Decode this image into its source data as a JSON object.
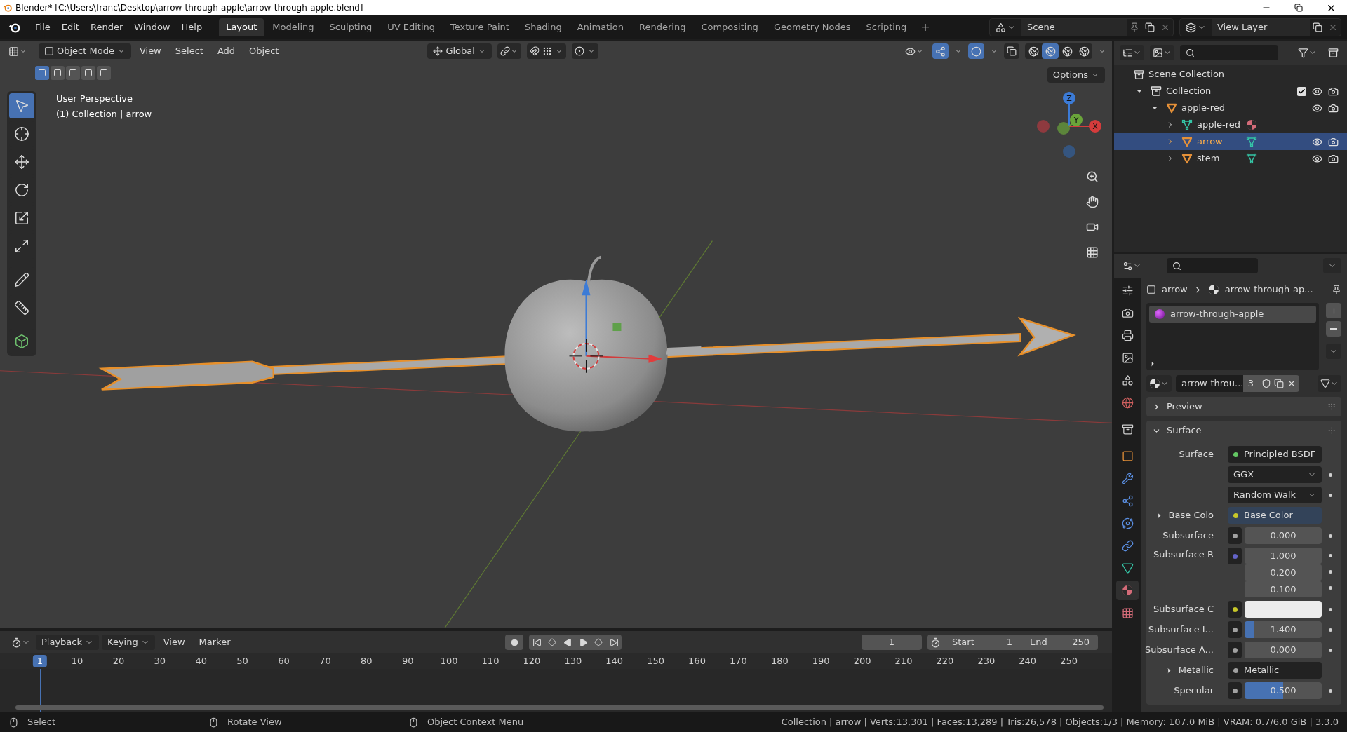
{
  "window": {
    "title": "Blender* [C:\\Users\\franc\\Desktop\\arrow-through-apple\\arrow-through-apple.blend]"
  },
  "menu": [
    "File",
    "Edit",
    "Render",
    "Window",
    "Help"
  ],
  "workspaces": [
    {
      "label": "Layout",
      "selected": true
    },
    {
      "label": "Modeling",
      "selected": false
    },
    {
      "label": "Sculpting",
      "selected": false
    },
    {
      "label": "UV Editing",
      "selected": false
    },
    {
      "label": "Texture Paint",
      "selected": false
    },
    {
      "label": "Shading",
      "selected": false
    },
    {
      "label": "Animation",
      "selected": false
    },
    {
      "label": "Rendering",
      "selected": false
    },
    {
      "label": "Compositing",
      "selected": false
    },
    {
      "label": "Geometry Nodes",
      "selected": false
    },
    {
      "label": "Scripting",
      "selected": false
    }
  ],
  "add_workspace": "+",
  "scene": "Scene",
  "view_layer": "View Layer",
  "viewport": {
    "mode": "Object Mode",
    "menus": [
      "View",
      "Select",
      "Add",
      "Object"
    ],
    "orientation": "Global",
    "options": "Options",
    "info": [
      "User Perspective",
      "(1) Collection | arrow"
    ],
    "axes": [
      "Z",
      "Y",
      "X"
    ],
    "gizmos_on": true,
    "overlays_on": true,
    "select_modes": [
      {
        "selected": true
      },
      {
        "selected": false
      },
      {
        "selected": false
      },
      {
        "selected": false
      },
      {
        "selected": false
      }
    ],
    "tools": [
      {
        "kind": "select",
        "selected": true
      },
      {
        "kind": "cursor",
        "selected": false
      },
      {
        "kind": "move",
        "selected": false
      },
      {
        "kind": "rotate",
        "selected": false
      },
      {
        "kind": "scale",
        "selected": false
      },
      {
        "kind": "transform",
        "selected": false
      },
      {
        "kind": "annotate",
        "selected": false
      },
      {
        "kind": "measure",
        "selected": false
      },
      {
        "kind": "add",
        "selected": false
      }
    ],
    "shading": [
      {
        "selected": false
      },
      {
        "selected": true
      },
      {
        "selected": false
      },
      {
        "selected": false
      }
    ]
  },
  "outliner": {
    "root": "Scene Collection",
    "items": [
      {
        "label": "Collection",
        "kind": "collection",
        "expanded": true,
        "checked": true,
        "selected": false,
        "children": [
          {
            "label": "apple-red",
            "kind": "object",
            "expanded": true,
            "selected": false,
            "children": [
              {
                "label": "apple-red",
                "kind": "mesh",
                "expanded": false,
                "selected": false,
                "badge": {
                  "kind": "material"
                }
              },
              {
                "label": "arrow",
                "kind": "object",
                "expanded": false,
                "selected": true,
                "badge": {
                  "kind": "mesh"
                }
              },
              {
                "label": "stem",
                "kind": "object",
                "expanded": false,
                "selected": false,
                "badge": {
                  "kind": "mesh"
                }
              }
            ]
          }
        ]
      }
    ]
  },
  "properties": {
    "tabs": [
      {
        "kind": "tool",
        "selected": false
      },
      {
        "kind": "render",
        "selected": false
      },
      {
        "kind": "output",
        "selected": false
      },
      {
        "kind": "view_layer",
        "selected": false
      },
      {
        "kind": "scene",
        "selected": false
      },
      {
        "kind": "world",
        "selected": false
      },
      {
        "kind": "collection",
        "selected": false
      },
      {
        "kind": "object",
        "selected": false
      },
      {
        "kind": "modifier",
        "selected": false
      },
      {
        "kind": "particles",
        "selected": false
      },
      {
        "kind": "physics",
        "selected": false
      },
      {
        "kind": "constraints",
        "selected": false
      },
      {
        "kind": "data",
        "selected": false
      },
      {
        "kind": "material",
        "selected": true
      },
      {
        "kind": "texture",
        "selected": false
      }
    ],
    "breadcrumb": [
      "arrow",
      "arrow-through-ap..."
    ],
    "slots": [
      {
        "label": "arrow-through-apple",
        "selected": true
      }
    ],
    "material": "arrow-throu...",
    "users": "3",
    "panels": [
      {
        "label": "Preview",
        "expanded": false
      },
      {
        "label": "Surface",
        "expanded": true
      }
    ],
    "rows": [
      {
        "kind": "link",
        "label": "Surface",
        "value": "Principled BSDF",
        "color": "#63c763",
        "expandable": false,
        "highlighted": false
      },
      {
        "kind": "dropdown",
        "value": "GGX"
      },
      {
        "kind": "dropdown",
        "value": "Random Walk"
      },
      {
        "kind": "link",
        "label": "Base Colo",
        "value": "Base Color",
        "color": "#c7c729",
        "expandable": true,
        "highlighted": true
      },
      {
        "kind": "slider",
        "label": "Subsurface",
        "value": "0.000",
        "color": "#a1a1a1"
      },
      {
        "kind": "vector",
        "label": "Subsurface R",
        "values": [
          "1.000",
          "0.200",
          "0.100"
        ],
        "color": "#6363c7"
      },
      {
        "kind": "swatch",
        "label": "Subsurface C",
        "swatch": {
          "color": "#ececec"
        },
        "color": "#c7c729"
      },
      {
        "kind": "slider",
        "label": "Subsurface I...",
        "value": "1.400",
        "level": 0.12,
        "color": "#a1a1a1"
      },
      {
        "kind": "slider",
        "label": "Subsurface A...",
        "value": "0.000",
        "color": "#a1a1a1"
      },
      {
        "kind": "link",
        "label": "Metallic",
        "value": "Metallic",
        "color": "#a1a1a1",
        "expandable": true,
        "highlighted": false
      },
      {
        "kind": "slider",
        "label": "Specular",
        "value": "0.500",
        "level": 0.5,
        "color": "#a1a1a1"
      }
    ]
  },
  "timeline": {
    "menus": [
      "Playback",
      "Keying",
      "View",
      "Marker"
    ],
    "frame": "1",
    "start_label": "Start",
    "start": "1",
    "end_label": "End",
    "end": "250",
    "ticks": [
      {
        "label": "1",
        "selected": true
      },
      {
        "label": "10",
        "selected": false
      },
      {
        "label": "20",
        "selected": false
      },
      {
        "label": "30",
        "selected": false
      },
      {
        "label": "40",
        "selected": false
      },
      {
        "label": "50",
        "selected": false
      },
      {
        "label": "60",
        "selected": false
      },
      {
        "label": "70",
        "selected": false
      },
      {
        "label": "80",
        "selected": false
      },
      {
        "label": "90",
        "selected": false
      },
      {
        "label": "100",
        "selected": false
      },
      {
        "label": "110",
        "selected": false
      },
      {
        "label": "120",
        "selected": false
      },
      {
        "label": "130",
        "selected": false
      },
      {
        "label": "140",
        "selected": false
      },
      {
        "label": "150",
        "selected": false
      },
      {
        "label": "160",
        "selected": false
      },
      {
        "label": "170",
        "selected": false
      },
      {
        "label": "180",
        "selected": false
      },
      {
        "label": "190",
        "selected": false
      },
      {
        "label": "200",
        "selected": false
      },
      {
        "label": "210",
        "selected": false
      },
      {
        "label": "220",
        "selected": false
      },
      {
        "label": "230",
        "selected": false
      },
      {
        "label": "240",
        "selected": false
      },
      {
        "label": "250",
        "selected": false
      }
    ]
  },
  "status": {
    "hints": [
      "Select",
      "Rotate View",
      "Object Context Menu"
    ],
    "stats": "Collection | arrow | Verts:13,301 | Faces:13,289 | Tris:26,578 | Objects:1/3 | Memory: 107.0 MiB | VRAM: 0.7/6.0 GiB | 3.3.0"
  }
}
